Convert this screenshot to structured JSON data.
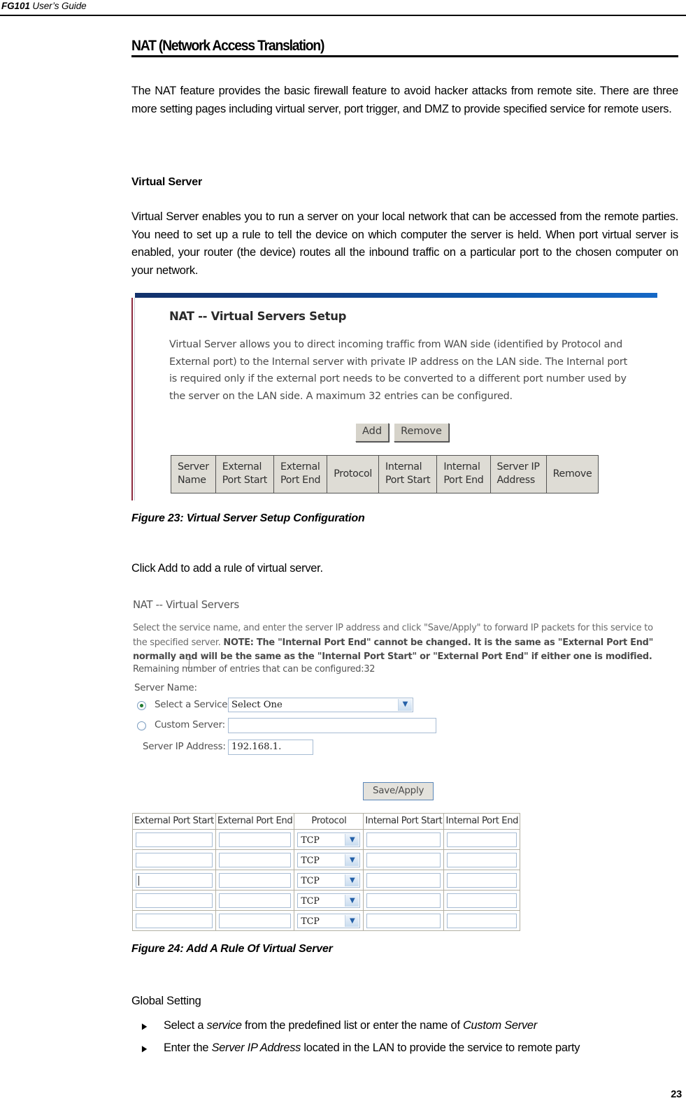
{
  "header": {
    "doc_name": "FG101",
    "doc_subtitle": " User’s Guide"
  },
  "chapter": {
    "title": "NAT (Network Access Translation)",
    "intro": "The NAT feature provides the basic firewall feature to avoid hacker attacks from remote site. There are three more setting pages including virtual server, port trigger, and DMZ to provide specified service for remote users."
  },
  "virtual_server": {
    "heading": "Virtual Server",
    "paragraph": "Virtual Server enables you to run a server on your local network that can be accessed from the remote parties. You need to set up a rule to tell the device on which computer the server is held. When port virtual server is enabled, your router (the device) routes all the inbound traffic on a particular port to the chosen computer on your network.",
    "click_add_text": "Click Add to add a rule of virtual server."
  },
  "figure23": {
    "caption": "Figure 23: Virtual Server Setup Configuration",
    "screenshot": {
      "title": "NAT -- Virtual Servers Setup",
      "description": "Virtual Server allows you to direct incoming traffic from WAN side (identified by Protocol and External port) to the Internal server with private IP address on the LAN side. The Internal port is required only if the external port needs to be converted to a different port number used by the server on the LAN side. A maximum 32 entries can be configured.",
      "add_button": "Add",
      "remove_button": "Remove",
      "table_headers": [
        "Server\nName",
        "External\nPort Start",
        "External\nPort End",
        "Protocol",
        "Internal\nPort Start",
        "Internal\nPort End",
        "Server IP\nAddress",
        "Remove"
      ]
    }
  },
  "figure24": {
    "caption": "Figure 24: Add A Rule Of Virtual Server",
    "screenshot": {
      "title": "NAT -- Virtual Servers",
      "desc_part1": "Select the service name, and enter the server IP address and click \"Save/Apply\" to forward IP packets for this service to the specified server. ",
      "desc_bold": "NOTE: The \"Internal Port End\" cannot be changed. It is the same as \"External Port End\" normally and will be the same as the \"Internal Port Start\" or \"External Port End\" if either one is modified.",
      "remaining_entries": "Remaining number of entries that can be configured:32",
      "server_name_label": "Server Name:",
      "select_service_label": "Select a Service:",
      "select_service_value": "Select One",
      "custom_server_label": "Custom Server:",
      "custom_server_value": "",
      "server_ip_label": "Server IP Address:",
      "server_ip_value": "192.168.1.",
      "save_apply_button": "Save/Apply",
      "ports_table": {
        "headers": [
          "External Port Start",
          "External Port End",
          "Protocol",
          "Internal Port Start",
          "Internal Port End"
        ],
        "rows": [
          {
            "external_start": "",
            "external_end": "",
            "protocol": "TCP",
            "internal_start": "",
            "internal_end": ""
          },
          {
            "external_start": "",
            "external_end": "",
            "protocol": "TCP",
            "internal_start": "",
            "internal_end": ""
          },
          {
            "external_start": "",
            "external_end": "",
            "protocol": "TCP",
            "internal_start": "",
            "internal_end": ""
          },
          {
            "external_start": "",
            "external_end": "",
            "protocol": "TCP",
            "internal_start": "",
            "internal_end": ""
          },
          {
            "external_start": "",
            "external_end": "",
            "protocol": "TCP",
            "internal_start": "",
            "internal_end": ""
          }
        ]
      }
    }
  },
  "global_setting": {
    "heading": "Global Setting",
    "bullet_marker": "▶",
    "bullets": [
      {
        "pre": "Select a ",
        "em1": "service",
        "mid": " from the predefined list or enter the name of ",
        "em2": "Custom Server",
        "post": ""
      },
      {
        "pre": "Enter the ",
        "em1": "Server IP Address",
        "mid": " located in the LAN to provide the service to remote party",
        "em2": "",
        "post": ""
      }
    ]
  },
  "footer": {
    "page_number": "23"
  }
}
